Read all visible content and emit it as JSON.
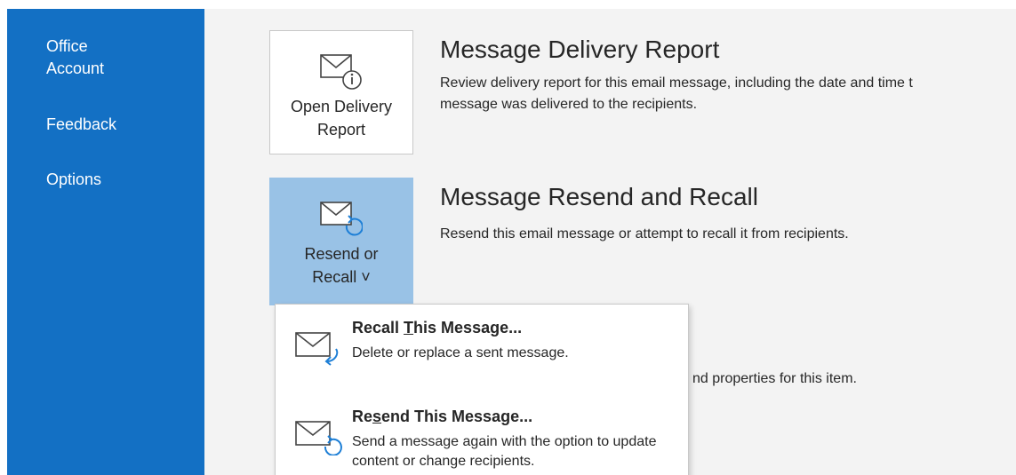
{
  "sidebar": {
    "items": [
      {
        "label": "Office\nAccount"
      },
      {
        "label": "Feedback"
      },
      {
        "label": "Options"
      }
    ]
  },
  "delivery_report": {
    "button_label": "Open Delivery\nReport",
    "title": "Message Delivery Report",
    "description": "Review delivery report for this email message, including the date and time t",
    "description_line2": "message was delivered to the recipients."
  },
  "resend_recall": {
    "button_label": "Resend or\nRecall ˅",
    "title": "Message Resend and Recall",
    "description": "Resend this email message or attempt to recall it from recipients."
  },
  "properties": {
    "description_fragment": "nd properties for this item."
  },
  "dropdown": {
    "items": [
      {
        "title_pre": "Recall ",
        "title_accel": "T",
        "title_post": "his Message...",
        "description": "Delete or replace a sent message."
      },
      {
        "title_pre": "Re",
        "title_accel": "s",
        "title_post": "end This Message...",
        "description": "Send a message again with the option to update content or change recipients."
      }
    ]
  },
  "colors": {
    "sidebar_bg": "#1370c4",
    "selected_tile_bg": "#99c2e6",
    "page_bg": "#f3f3f3",
    "icon_accent": "#1e7fd6"
  },
  "icons": [
    "envelope-info-icon",
    "envelope-recall-icon",
    "envelope-curved-arrow-icon",
    "envelope-refresh-icon"
  ]
}
